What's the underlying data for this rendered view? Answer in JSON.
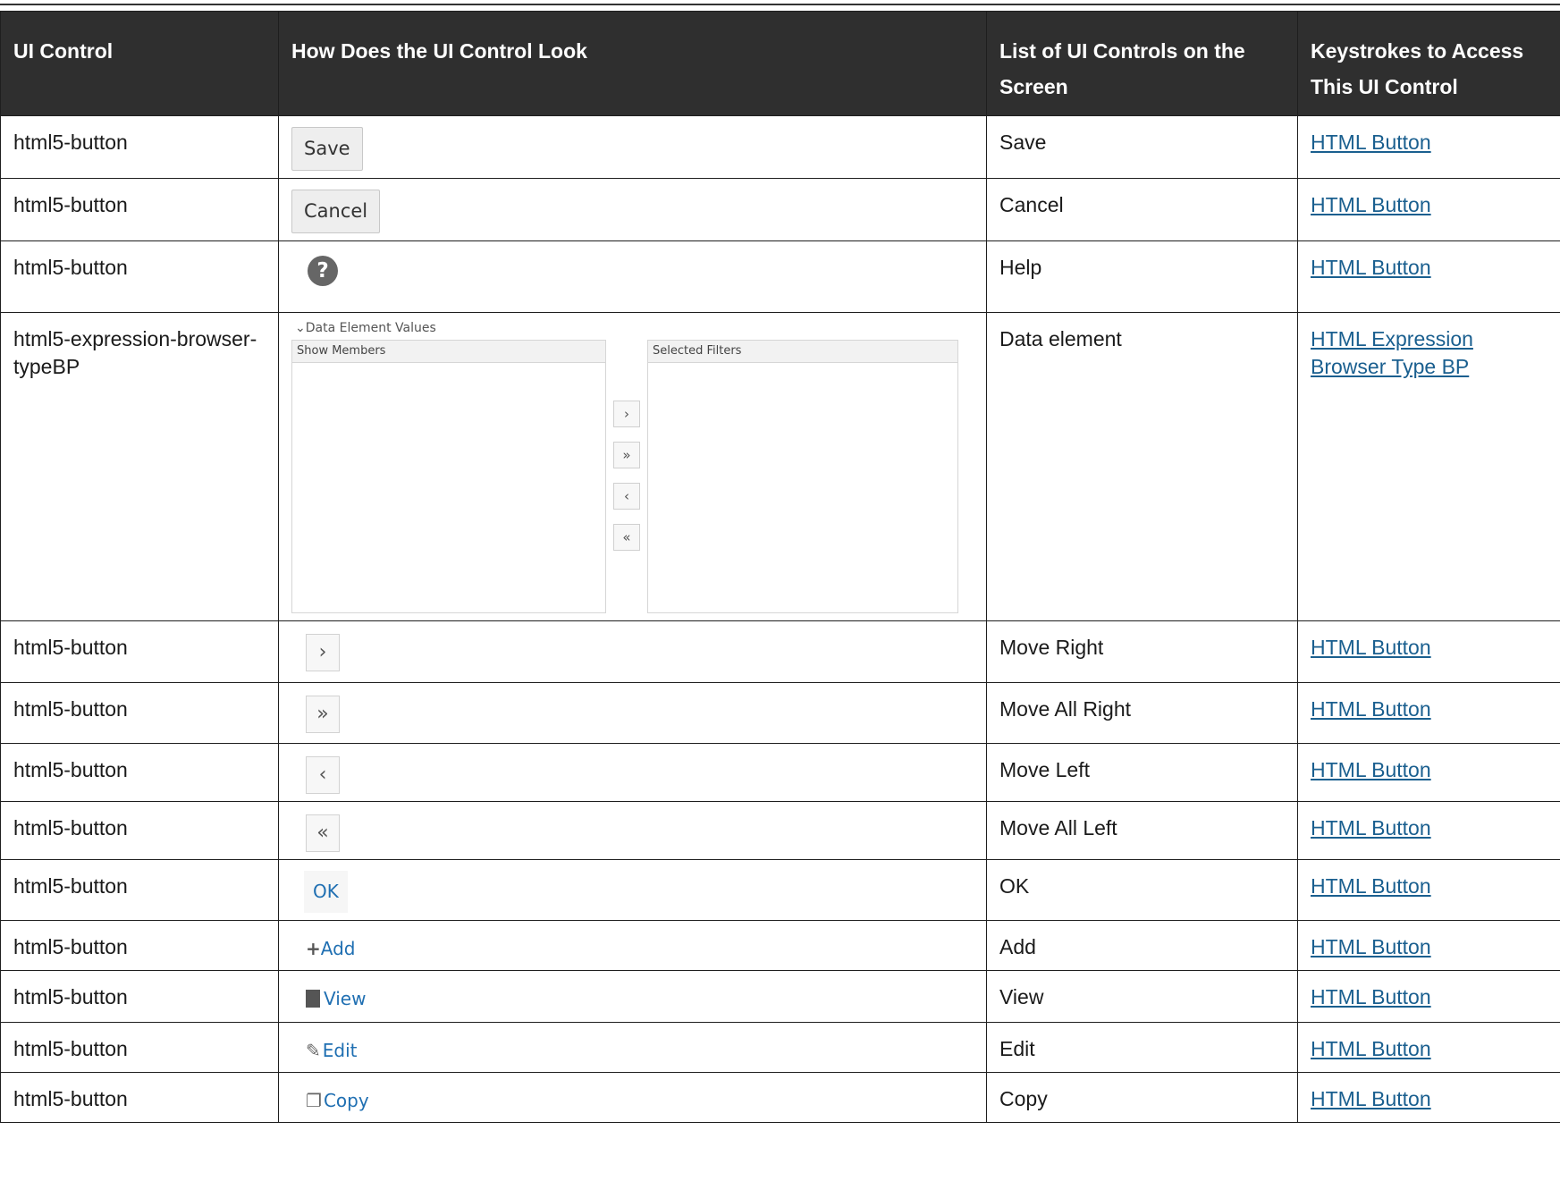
{
  "table": {
    "headers": [
      "UI Control",
      "How Does the UI Control Look",
      "List of UI Controls on the Screen",
      "Keystrokes to Access This UI Control"
    ],
    "rows": [
      {
        "control": "html5-button",
        "look": {
          "kind": "button",
          "label": "Save"
        },
        "name": "Save",
        "keys": "HTML Button"
      },
      {
        "control": "html5-button",
        "look": {
          "kind": "button",
          "label": "Cancel"
        },
        "name": "Cancel",
        "keys": "HTML Button"
      },
      {
        "control": "html5-button",
        "look": {
          "kind": "help-icon",
          "label": "?"
        },
        "name": "Help",
        "keys": "HTML Button"
      },
      {
        "control": "html5-expression-browser-typeBP",
        "look": {
          "kind": "expression-browser",
          "title": "Data Element Values",
          "left_header": "Show Members",
          "right_header": "Selected Filters",
          "buttons": [
            "›",
            "»",
            "‹",
            "«"
          ]
        },
        "name": "Data element",
        "keys": "HTML Expression Browser Type BP"
      },
      {
        "control": "html5-button",
        "look": {
          "kind": "arrow",
          "label": "›"
        },
        "name": "Move Right",
        "keys": "HTML Button"
      },
      {
        "control": "html5-button",
        "look": {
          "kind": "arrow",
          "label": "»"
        },
        "name": "Move All Right",
        "keys": "HTML Button"
      },
      {
        "control": "html5-button",
        "look": {
          "kind": "arrow",
          "label": "‹"
        },
        "name": "Move Left",
        "keys": "HTML Button"
      },
      {
        "control": "html5-button",
        "look": {
          "kind": "arrow",
          "label": "«"
        },
        "name": "Move All Left",
        "keys": "HTML Button"
      },
      {
        "control": "html5-button",
        "look": {
          "kind": "ok",
          "label": "OK"
        },
        "name": "OK",
        "keys": "HTML Button"
      },
      {
        "control": "html5-button",
        "look": {
          "kind": "toolbar",
          "icon": "plus-icon",
          "label": "Add"
        },
        "name": "Add",
        "keys": "HTML Button"
      },
      {
        "control": "html5-button",
        "look": {
          "kind": "toolbar",
          "icon": "document-icon",
          "label": "View"
        },
        "name": "View",
        "keys": "HTML Button"
      },
      {
        "control": "html5-button",
        "look": {
          "kind": "toolbar",
          "icon": "edit-icon",
          "label": "Edit"
        },
        "name": "Edit",
        "keys": "HTML Button"
      },
      {
        "control": "html5-button",
        "look": {
          "kind": "toolbar",
          "icon": "copy-icon",
          "label": "Copy"
        },
        "name": "Copy",
        "keys": "HTML Button"
      }
    ]
  }
}
